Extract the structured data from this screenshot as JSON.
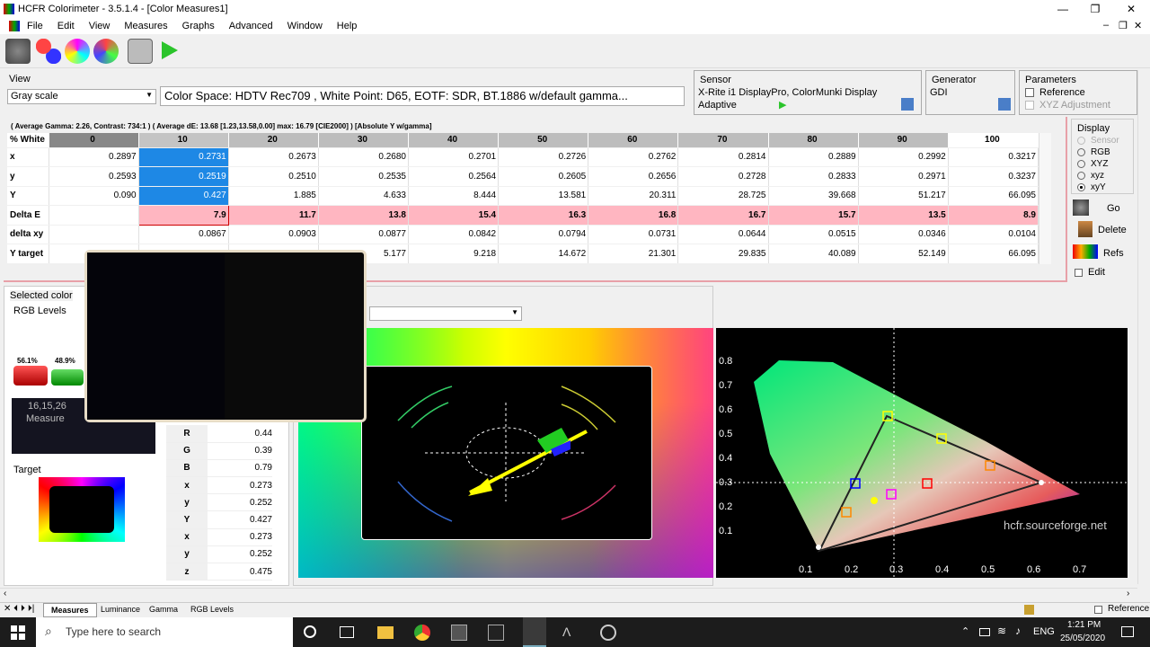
{
  "window": {
    "title": "HCFR Colorimeter - 3.5.1.4 - [Color Measures1]",
    "minimize": "—",
    "maximize": "❐",
    "close": "✕"
  },
  "menu": [
    "File",
    "Edit",
    "View",
    "Measures",
    "Graphs",
    "Advanced",
    "Window",
    "Help"
  ],
  "child_controls": {
    "min": "–",
    "restore": "❐",
    "close": "✕"
  },
  "view": {
    "label": "View",
    "selected": "Gray scale",
    "colorspace": "Color Space: HDTV Rec709 , White Point: D65, EOTF:  SDR, BT.1886 w/default gamma..."
  },
  "sensor": {
    "label": "Sensor",
    "name": "X-Rite i1 DisplayPro, ColorMunki Display",
    "mode": "Adaptive"
  },
  "generator": {
    "label": "Generator",
    "name": "GDI"
  },
  "parameters": {
    "label": "Parameters",
    "reference": "Reference",
    "xyz_adjust": "XYZ Adjustment"
  },
  "summary": "( Average Gamma: 2.26, Contrast: 734:1 ) ( Average dE: 13.68 [1.23,13.58,0.00] max: 16.79 [CIE2000] ) [Absolute Y w/gamma]",
  "table": {
    "columns": [
      "% White",
      "0",
      "10",
      "20",
      "30",
      "40",
      "50",
      "60",
      "70",
      "80",
      "90",
      "100"
    ],
    "rows": [
      {
        "name": "x",
        "values": [
          "0.2897",
          "0.2731",
          "0.2673",
          "0.2680",
          "0.2701",
          "0.2726",
          "0.2762",
          "0.2814",
          "0.2889",
          "0.2992",
          "0.3217"
        ]
      },
      {
        "name": "y",
        "values": [
          "0.2593",
          "0.2519",
          "0.2510",
          "0.2535",
          "0.2564",
          "0.2605",
          "0.2656",
          "0.2728",
          "0.2833",
          "0.2971",
          "0.3237"
        ]
      },
      {
        "name": "Y",
        "values": [
          "0.090",
          "0.427",
          "1.885",
          "4.633",
          "8.444",
          "13.581",
          "20.311",
          "28.725",
          "39.668",
          "51.217",
          "66.095"
        ]
      },
      {
        "name": "Delta E",
        "values": [
          "",
          "7.9",
          "11.7",
          "13.8",
          "15.4",
          "16.3",
          "16.8",
          "16.7",
          "15.7",
          "13.5",
          "8.9"
        ]
      },
      {
        "name": "delta xy",
        "values": [
          "",
          "0.0867",
          "0.0903",
          "0.0877",
          "0.0842",
          "0.0794",
          "0.0731",
          "0.0644",
          "0.0515",
          "0.0346",
          "0.0104"
        ]
      },
      {
        "name": "Y target",
        "values": [
          "",
          "",
          "",
          "5.177",
          "9.218",
          "14.672",
          "21.301",
          "29.835",
          "40.089",
          "52.149",
          "66.095"
        ]
      }
    ]
  },
  "display": {
    "label": "Display",
    "options": [
      "Sensor",
      "RGB",
      "XYZ",
      "xyz",
      "xyY"
    ],
    "selected": "xyY"
  },
  "actions": {
    "go": "Go",
    "delete": "Delete",
    "refs": "Refs",
    "edit": "Edit"
  },
  "selected_color": {
    "label": "Selected color",
    "rgb_levels": "RGB Levels",
    "bar1": "56.1%",
    "bar2": "48.9%",
    "swatch_value": "16,15,26",
    "measure": "Measure",
    "target": "Target"
  },
  "values_panel": [
    {
      "k": "R",
      "v": "0.44"
    },
    {
      "k": "G",
      "v": "0.39"
    },
    {
      "k": "B",
      "v": "0.79"
    },
    {
      "k": "x",
      "v": "0.273"
    },
    {
      "k": "y",
      "v": "0.252"
    },
    {
      "k": "Y",
      "v": "0.427"
    },
    {
      "k": "x",
      "v": "0.273"
    },
    {
      "k": "y",
      "v": "0.252"
    },
    {
      "k": "z",
      "v": "0.475"
    }
  ],
  "cie": {
    "yticks": [
      "0.8",
      "0.7",
      "0.6",
      "0.5",
      "0.4",
      "0.3",
      "0.2",
      "0.1"
    ],
    "xticks": [
      "0.1",
      "0.2",
      "0.3",
      "0.4",
      "0.5",
      "0.6",
      "0.7"
    ],
    "watermark": "hcfr.sourceforge.net"
  },
  "bottom_tabs": [
    "Measures",
    "Luminance",
    "Gamma",
    "RGB Levels"
  ],
  "status": {
    "reference": "Reference"
  },
  "taskbar": {
    "search": "Type here to search",
    "lang": "ENG",
    "time": "1:21 PM",
    "date": "25/05/2020"
  }
}
